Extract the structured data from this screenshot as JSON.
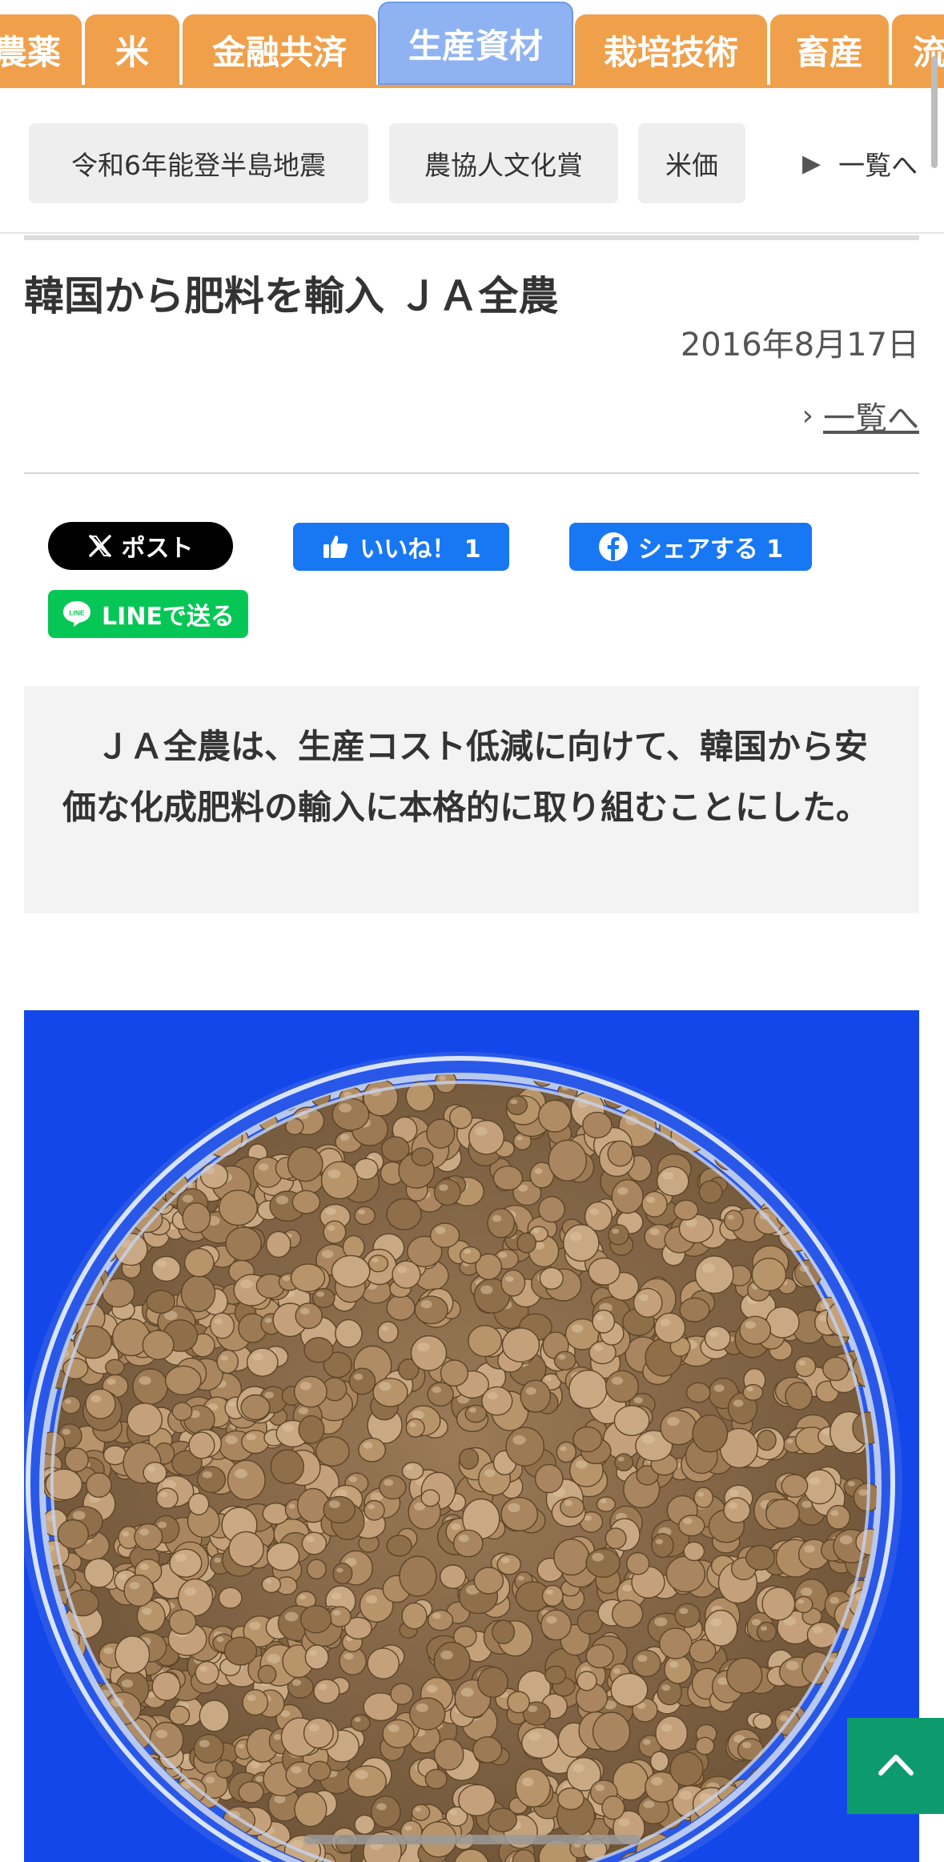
{
  "tabs": [
    {
      "label": "農薬"
    },
    {
      "label": "米"
    },
    {
      "label": "金融共済"
    },
    {
      "label": "生産資材",
      "active": true
    },
    {
      "label": "栽培技術"
    },
    {
      "label": "畜産"
    },
    {
      "label": "流"
    }
  ],
  "keywords": [
    {
      "label": "令和6年能登半島地震"
    },
    {
      "label": "農協人文化賞"
    },
    {
      "label": "米価"
    }
  ],
  "keywords_more": "一覧へ",
  "article": {
    "title": "韓国から肥料を輸入 ＪＡ全農",
    "date": "2016年8月17日",
    "back_to_list": "一覧へ",
    "lead": "　ＪＡ全農は、生産コスト低減に向けて、韓国から安価な化成肥料の輸入に本格的に取り組むことにした。"
  },
  "share": {
    "x_post": "ポスト",
    "like": "いいね！ 1",
    "share": "シェアする 1",
    "line": "LINEで送る"
  },
  "colors": {
    "tab_orange": "#f0a04b",
    "tab_active": "#8fb3f2",
    "x_black": "#000000",
    "facebook_blue": "#1877f2",
    "line_green": "#06c755",
    "to_top_green": "#0d9b6e"
  },
  "icons": {
    "x": "x-logo-icon",
    "like": "thumbs-up-icon",
    "share": "facebook-icon",
    "line": "line-logo-icon",
    "to_top": "chevron-up-icon",
    "more": "triangle-right-icon",
    "back": "chevron-right-icon"
  }
}
